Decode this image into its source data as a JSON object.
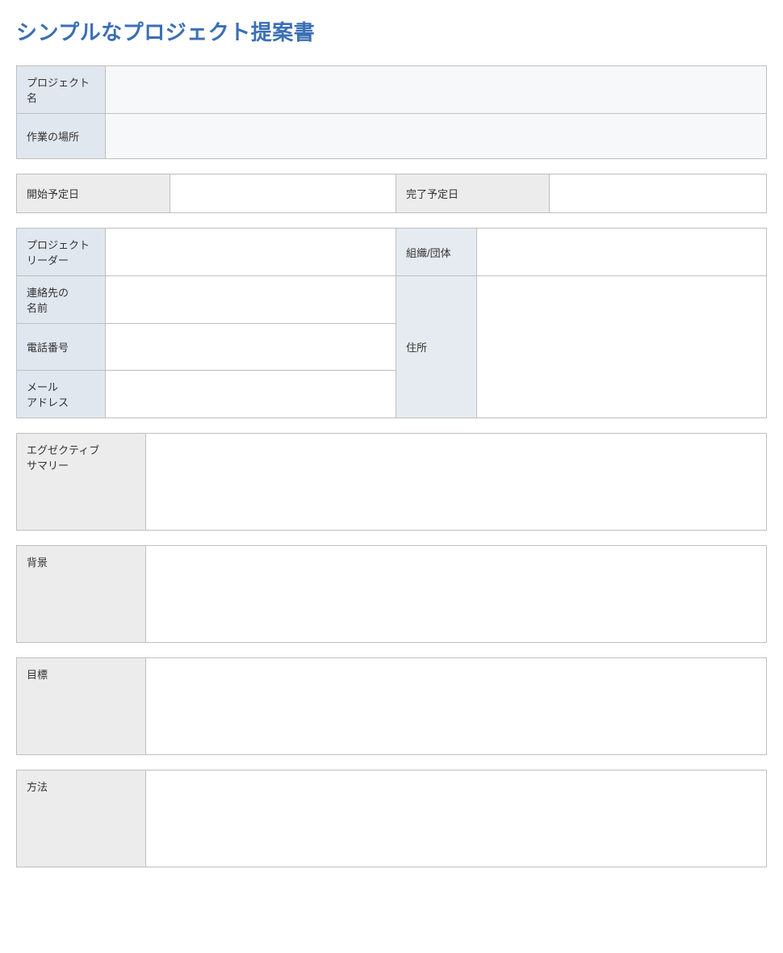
{
  "title": "シンプルなプロジェクト提案書",
  "section1": {
    "project_name_label": "プロジェクト名",
    "project_name_value": "",
    "work_location_label": "作業の場所",
    "work_location_value": ""
  },
  "section2": {
    "start_date_label": "開始予定日",
    "start_date_value": "",
    "end_date_label": "完了予定日",
    "end_date_value": ""
  },
  "section3": {
    "leader_label": "プロジェクト\nリーダー",
    "leader_value": "",
    "org_label": "組織/団体",
    "org_value": "",
    "contact_name_label": "連絡先の\n名前",
    "contact_name_value": "",
    "phone_label": "電話番号",
    "phone_value": "",
    "email_label": "メール\nアドレス",
    "email_value": "",
    "address_label": "住所",
    "address_value": ""
  },
  "sections": [
    {
      "label": "エグゼクティブ\nサマリー",
      "body": ""
    },
    {
      "label": "背景",
      "body": ""
    },
    {
      "label": "目標",
      "body": ""
    },
    {
      "label": "方法",
      "body": ""
    }
  ]
}
